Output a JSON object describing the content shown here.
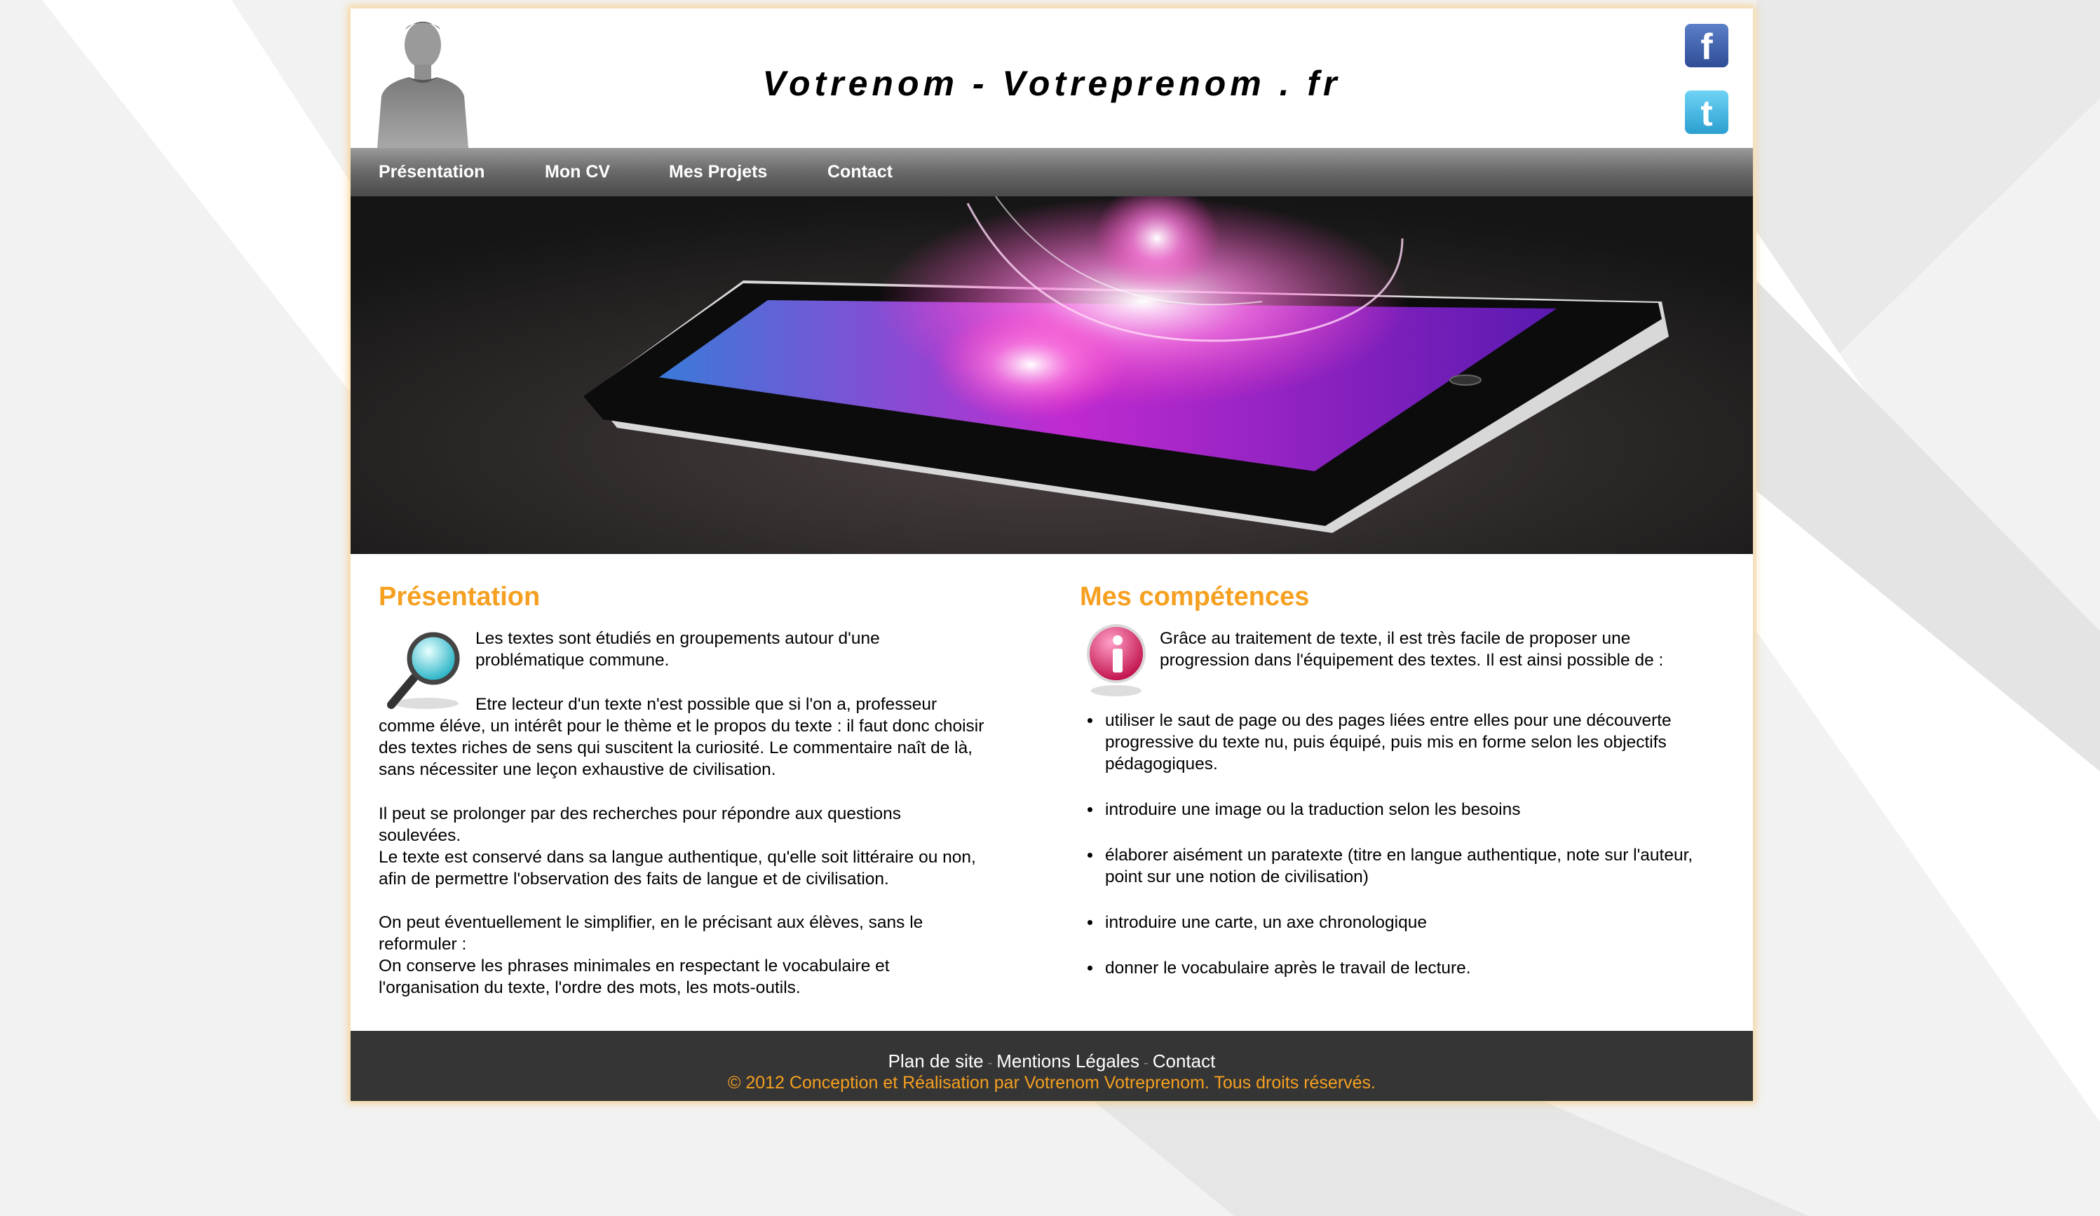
{
  "header": {
    "site_title": "Votrenom - Votreprenom . fr",
    "social": [
      {
        "name": "facebook",
        "glyph": "f",
        "color": "#3b5998"
      },
      {
        "name": "twitter",
        "glyph": "t",
        "color": "#33b5e5"
      }
    ]
  },
  "nav": {
    "items": [
      {
        "label": "Présentation"
      },
      {
        "label": "Mon CV"
      },
      {
        "label": "Mes Projets"
      },
      {
        "label": "Contact"
      }
    ]
  },
  "presentation": {
    "title": "Présentation",
    "icon": "magnifier-icon",
    "paragraphs": [
      "Les textes sont étudiés en groupements autour d'une problématique commune.",
      "Etre lecteur d'un texte n'est possible que si l'on a, professeur comme éléve, un intérêt pour le thème et le propos du texte : il faut donc choisir des textes riches de sens qui suscitent la curiosité. Le commentaire naît de là, sans nécessiter une leçon exhaustive de civilisation.",
      "Il peut se prolonger par des recherches pour répondre aux questions soulevées.",
      "Le texte est conservé dans sa langue authentique, qu'elle soit littéraire ou non, afin de permettre l'observation des faits de langue et de civilisation.",
      "On peut éventuellement le simplifier, en le précisant aux élèves, sans le reformuler :",
      "On conserve les phrases minimales en respectant le vocabulaire et l'organisation du texte, l'ordre des mots, les mots-outils."
    ]
  },
  "competences": {
    "title": "Mes compétences",
    "icon": "info-icon",
    "intro": "Grâce au traitement de texte, il est très facile de proposer une progression dans l'équipement des textes. Il est ainsi possible de :",
    "items": [
      "utiliser le saut de page ou des pages liées entre elles pour une découverte progressive du texte nu, puis équipé, puis mis en forme selon les objectifs pédagogiques.",
      "introduire une image ou la traduction selon les besoins",
      "élaborer aisément un paratexte (titre en langue authentique, note sur l'auteur, point sur une notion de civilisation)",
      "introduire une carte, un axe chronologique",
      "donner le vocabulaire après le travail de lecture."
    ]
  },
  "footer": {
    "links": [
      {
        "label": "Plan de site"
      },
      {
        "label": "Mentions Légales"
      },
      {
        "label": "Contact"
      }
    ],
    "separator": "-",
    "copyright": "© 2012 Conception et Réalisation par Votrenom Votreprenom. Tous droits réservés."
  },
  "colors": {
    "accent": "#f5a020",
    "footer_bg": "#353535",
    "page_glow": "#f8be5a"
  }
}
